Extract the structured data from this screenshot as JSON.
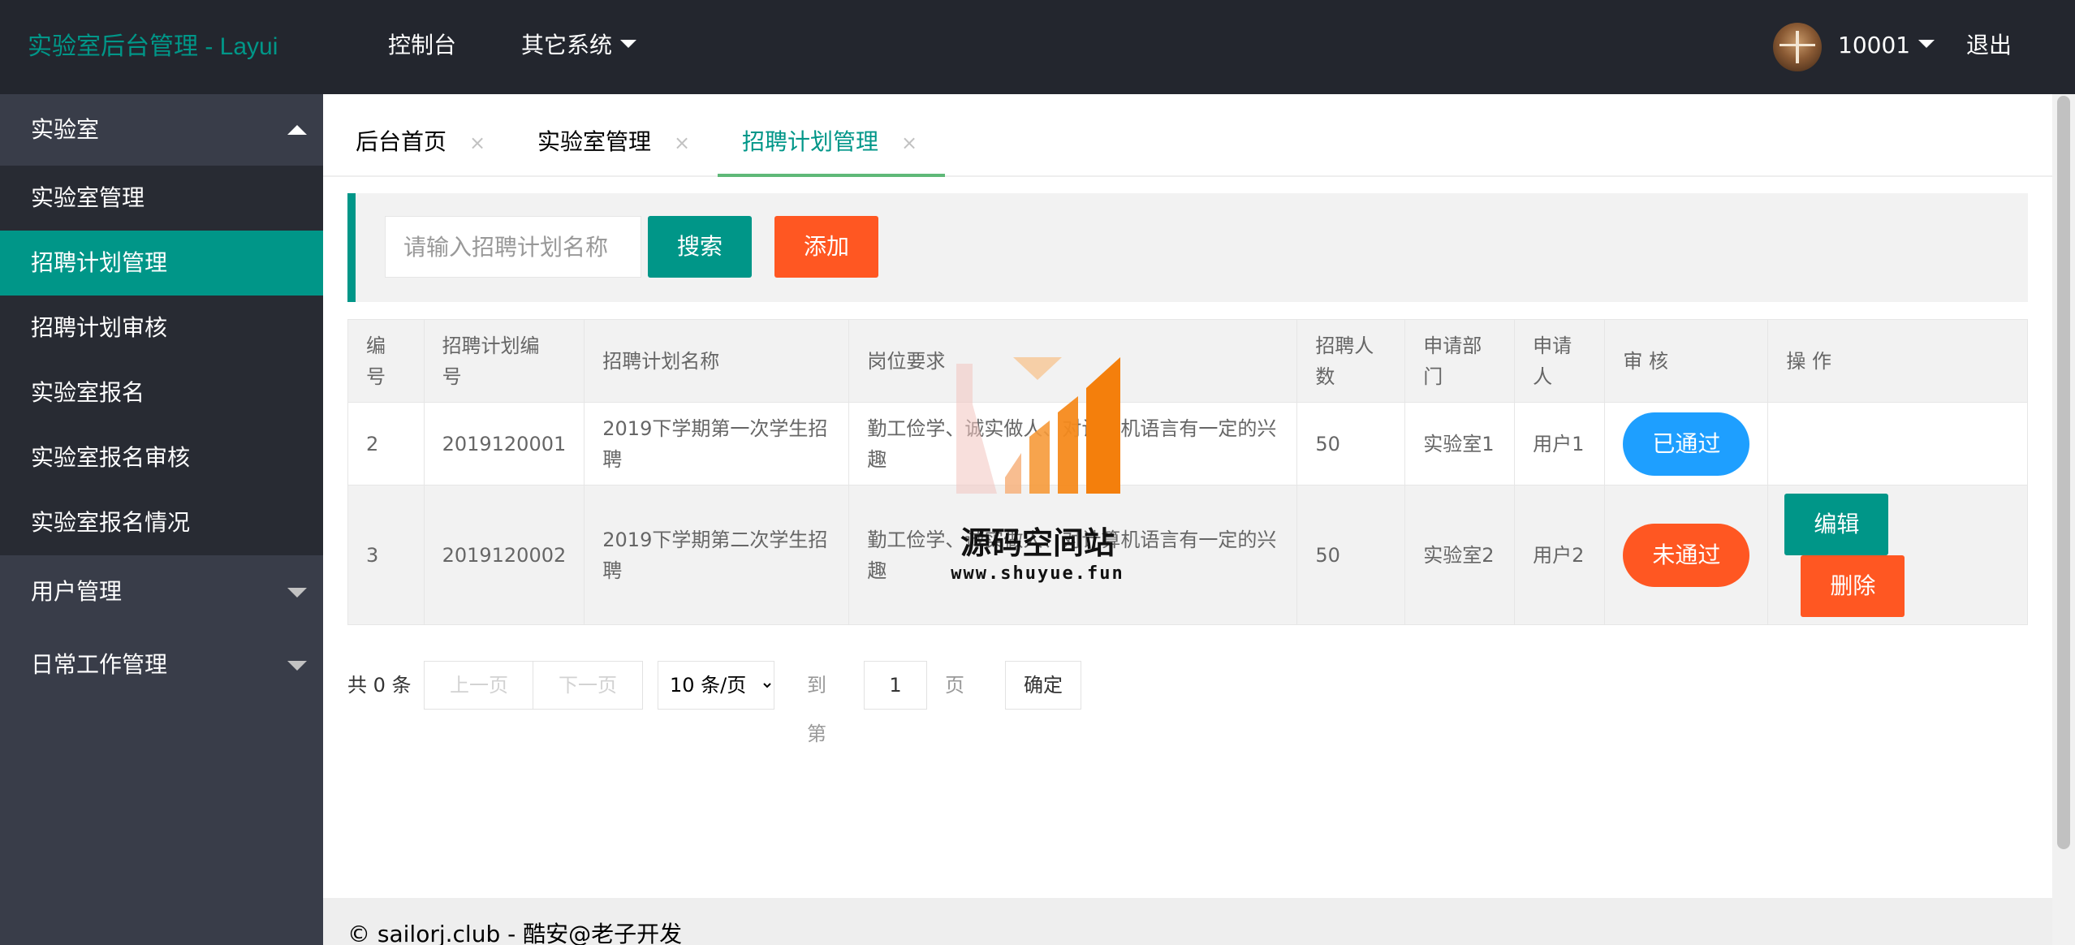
{
  "header": {
    "logo": "实验室后台管理 - Layui",
    "nav": [
      {
        "label": "控制台"
      },
      {
        "label": "其它系统"
      }
    ],
    "user": "10001",
    "logout": "退出"
  },
  "sidebar": {
    "groups": [
      {
        "label": "实验室",
        "expanded": true,
        "items": [
          {
            "label": "实验室管理"
          },
          {
            "label": "招聘计划管理",
            "active": true
          },
          {
            "label": "招聘计划审核"
          },
          {
            "label": "实验室报名"
          },
          {
            "label": "实验室报名审核"
          },
          {
            "label": "实验室报名情况"
          }
        ]
      },
      {
        "label": "用户管理",
        "expanded": false
      },
      {
        "label": "日常工作管理",
        "expanded": false
      }
    ]
  },
  "tabs": [
    {
      "label": "后台首页",
      "close": "×"
    },
    {
      "label": "实验室管理",
      "close": "×"
    },
    {
      "label": "招聘计划管理",
      "close": "×",
      "active": true
    }
  ],
  "search": {
    "placeholder": "请输入招聘计划名称",
    "value": "",
    "search_label": "搜索",
    "add_label": "添加"
  },
  "table": {
    "headers": [
      "编\n号",
      "招聘计划编\n号",
      "招聘计划名称",
      "岗位要求",
      "招聘人\n数",
      "申请部\n门",
      "申请\n人",
      "审 核",
      "操 作"
    ],
    "rows": [
      {
        "id": "2",
        "code": "2019120001",
        "name": "2019下学期第一次学生招\n聘",
        "req": "勤工俭学、诚实做人、对计算机语言有一定的兴\n趣",
        "count": "50",
        "dept": "实验室1",
        "applicant": "用户1",
        "status": "已通过",
        "ops": []
      },
      {
        "id": "3",
        "code": "2019120002",
        "name": "2019下学期第二次学生招\n聘",
        "req": "勤工俭学、诚实做人、对计算机语言有一定的兴\n趣",
        "count": "50",
        "dept": "实验室2",
        "applicant": "用户2",
        "status": "未通过",
        "ops": [
          "编辑",
          "删除"
        ]
      }
    ]
  },
  "pagination": {
    "total": "共 0 条",
    "prev": "上一页",
    "next": "下一页",
    "page_size": "10 条/页",
    "page_size_options": [
      "10 条/页"
    ],
    "goto_label": "到第",
    "page_value": "1",
    "page_suffix": "页",
    "confirm": "确定"
  },
  "watermark": {
    "text": "源码空间站",
    "url": "www.shuyue.fun"
  },
  "footer": "© sailorj.club - 酷安@老子开发",
  "colors": {
    "header_bg": "#23262e",
    "sidebar_bg": "#393d49",
    "sidebar_sub_bg": "#282b33",
    "accent": "#009688",
    "danger": "#ff5722",
    "info": "#1e9fff"
  }
}
